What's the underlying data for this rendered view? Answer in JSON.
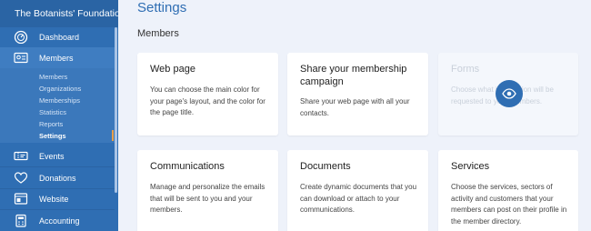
{
  "sidebar": {
    "org_name": "The Botanists' Foundation",
    "items": [
      {
        "label": "Dashboard",
        "icon": "dashboard-icon"
      },
      {
        "label": "Members",
        "icon": "members-card-icon"
      },
      {
        "label": "Events",
        "icon": "events-ticket-icon"
      },
      {
        "label": "Donations",
        "icon": "donations-heart-icon"
      },
      {
        "label": "Website",
        "icon": "website-icon"
      },
      {
        "label": "Accounting",
        "icon": "accounting-icon"
      }
    ],
    "submenu": [
      "Members",
      "Organizations",
      "Memberships",
      "Statistics",
      "Reports",
      "Settings"
    ],
    "active_sub": "Settings"
  },
  "page": {
    "title": "Settings",
    "section": "Members"
  },
  "cards": [
    {
      "title": "Web page",
      "text": "You can choose the main color for your page's layout, and the color for the page title."
    },
    {
      "title": "Share your membership campaign",
      "text": "Share your web page with all your contacts."
    },
    {
      "title": "Forms",
      "text": "Choose what information will be requested to your members."
    },
    {
      "title": "Communications",
      "text": "Manage and personalize the emails that will be sent to you and your members."
    },
    {
      "title": "Documents",
      "text": "Create dynamic documents that you can download or attach to your communications."
    },
    {
      "title": "Services",
      "text": "Choose the services, sectors of activity and customers that your members can post on their profile in the member directory."
    }
  ],
  "colors": {
    "accent": "#2f6eb3",
    "sidebar": "#2f6eb3",
    "active_marker": "#e8a14b"
  },
  "overlay_icon": "eye-icon"
}
